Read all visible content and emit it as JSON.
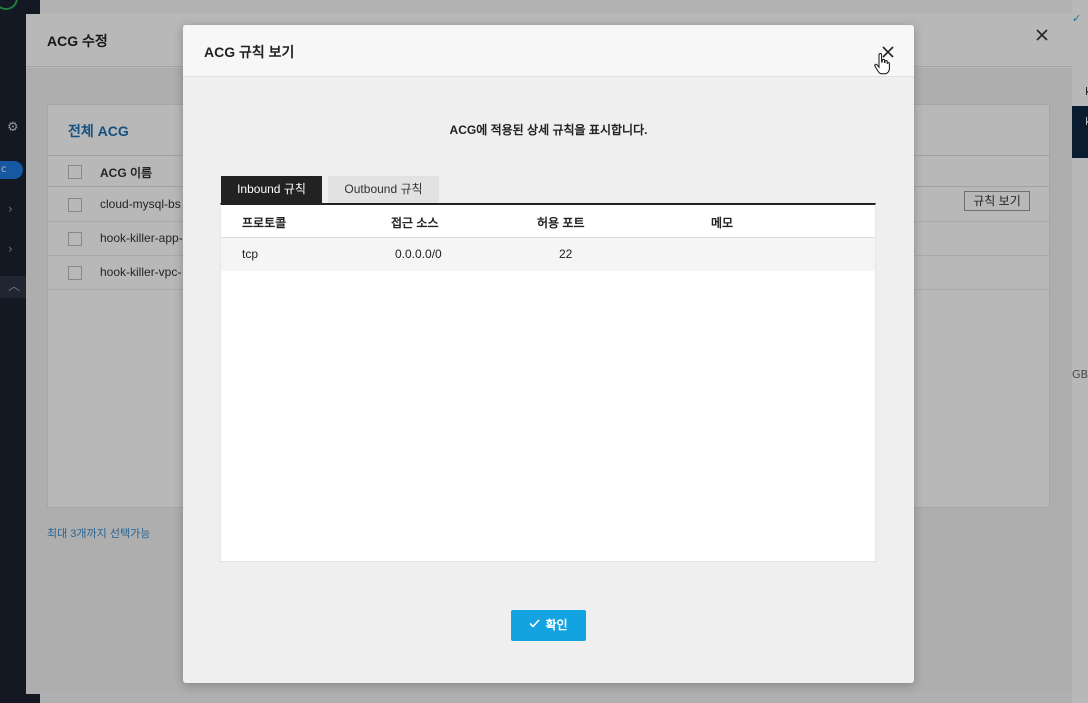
{
  "background": {
    "panel_title": "ACG 수정",
    "section_title": "전체 ACG",
    "column_header": "ACG 이름",
    "rows": [
      "cloud-mysql-bs",
      "hook-killer-app-",
      "hook-killer-vpc-"
    ],
    "rule_button_label": "규칙 보기",
    "max_note": "최대 3개까지 선택가능",
    "right_edge_gb": "GB,"
  },
  "modal": {
    "title": "ACG 규칙 보기",
    "description": "ACG에 적용된 상세 규칙을 표시합니다.",
    "tabs": [
      {
        "label": "Inbound 규칙",
        "active": true
      },
      {
        "label": "Outbound 규칙",
        "active": false
      }
    ],
    "columns": [
      "프로토콜",
      "접근 소스",
      "허용 포트",
      "메모"
    ],
    "rules": [
      {
        "protocol": "tcp",
        "source": "0.0.0.0/0",
        "port": "22",
        "memo": ""
      }
    ],
    "confirm_label": "확인"
  },
  "colors": {
    "accent": "#12a3e0",
    "active_tab": "#222222",
    "link_blue": "#1a6fb5"
  },
  "icons": [
    "close-icon",
    "hand-cursor-icon",
    "check-icon",
    "gear-icon",
    "chevron-right-icon",
    "chevron-up-icon"
  ]
}
